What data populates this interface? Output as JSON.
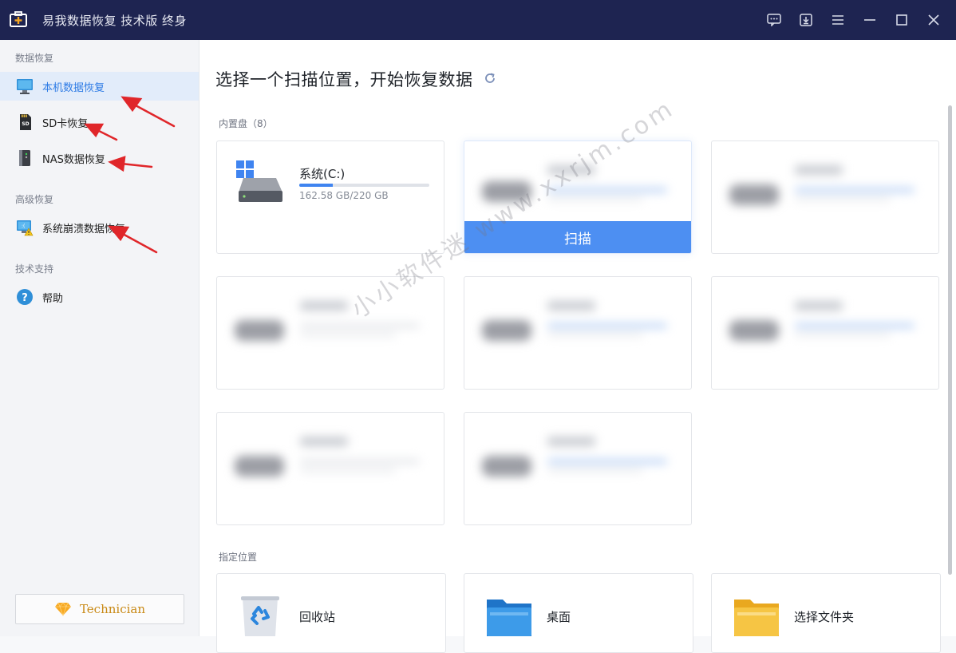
{
  "app": {
    "title": "易我数据恢复 技术版 终身",
    "logo_icon": "toolbox-plus-icon"
  },
  "window_controls": [
    {
      "name": "feedback-icon"
    },
    {
      "name": "update-download-icon"
    },
    {
      "name": "menu-icon"
    },
    {
      "name": "minimize-icon"
    },
    {
      "name": "maximize-icon"
    },
    {
      "name": "close-icon"
    }
  ],
  "sidebar": {
    "section_data_recovery": "数据恢复",
    "items": [
      {
        "label": "本机数据恢复",
        "icon": "monitor-icon",
        "active": true
      },
      {
        "label": "SD卡恢复",
        "icon": "sd-card-icon"
      },
      {
        "label": "NAS数据恢复",
        "icon": "nas-server-icon"
      },
      {
        "label": "系统崩溃数据恢复",
        "icon": "system-crash-icon"
      },
      {
        "label": "帮助",
        "icon": "help-icon"
      }
    ],
    "section_advanced": "高级恢复",
    "section_support": "技术支持",
    "technician_label": "Technician",
    "technician_icon": "diamond-icon"
  },
  "main": {
    "title": "选择一个扫描位置，开始恢复数据",
    "refresh_icon": "refresh-icon",
    "internal_label": "内置盘（8）",
    "disk_c": {
      "name": "系统(C:)",
      "size": "162.58 GB/220 GB",
      "usage": 0.26
    },
    "scan_label": "扫描",
    "specified_label": "指定位置",
    "locations": [
      {
        "label": "回收站",
        "icon": "recycle-bin-icon"
      },
      {
        "label": "桌面",
        "icon": "desktop-folder-icon"
      },
      {
        "label": "选择文件夹",
        "icon": "folder-icon"
      }
    ]
  },
  "watermark": "小小软件迷 www.xxrjm.com",
  "colors": {
    "titlebar": "#1e2451",
    "accent": "#4d8ff2",
    "annotation_arrow": "#e0262a",
    "technician": "#c98a16"
  }
}
